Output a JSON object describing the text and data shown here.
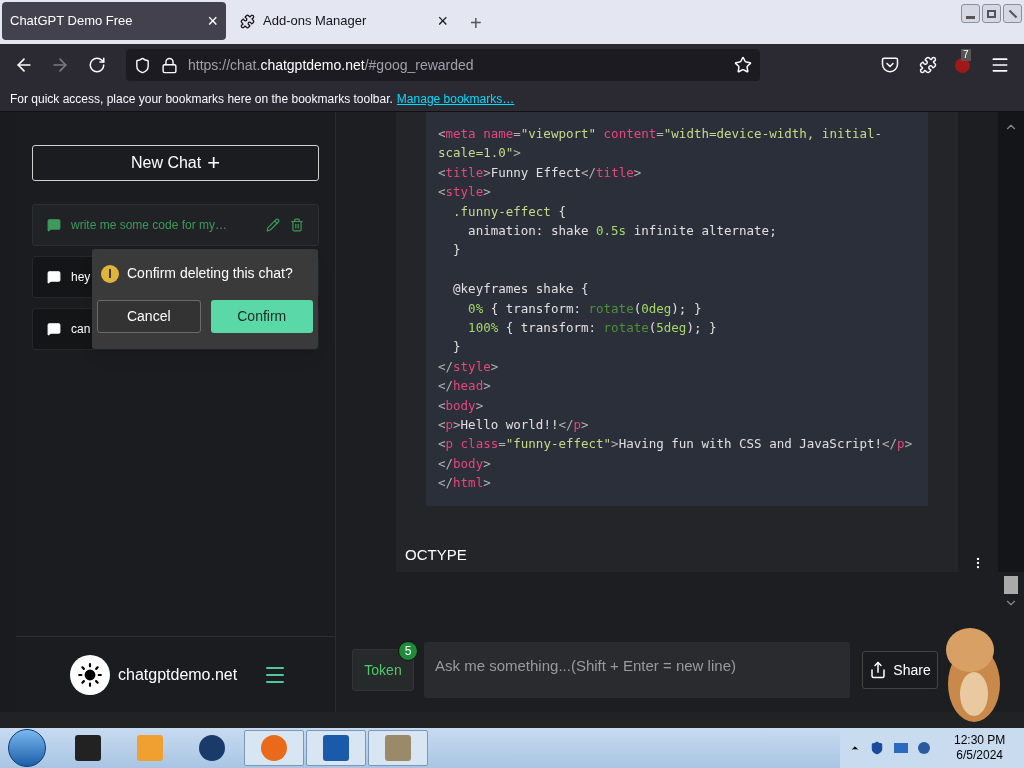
{
  "browser": {
    "tabs": [
      {
        "title": "ChatGPT Demo Free",
        "selected": true,
        "close": "×"
      },
      {
        "title": "Add-ons Manager",
        "selected": false,
        "close": "×"
      }
    ],
    "new_tab": "+",
    "url": {
      "prefix": "https://chat.",
      "domain": "chatgptdemo.net",
      "suffix": "/#goog_rewarded"
    },
    "extension_badge": "7",
    "bookmarks_bar": {
      "text": "For quick access, place your bookmarks here on the bookmarks toolbar.",
      "link": "Manage bookmarks…"
    }
  },
  "sidebar": {
    "new_chat": "New Chat",
    "new_chat_icon": "+",
    "chats": [
      {
        "title": "write me some code for my…",
        "selected": true
      },
      {
        "title": "hey",
        "selected": false
      },
      {
        "title": "can",
        "selected": false
      }
    ],
    "popconfirm": {
      "message": "Confirm deleting this chat?",
      "cancel": "Cancel",
      "confirm": "Confirm"
    },
    "site": "chatgptdemo.net"
  },
  "code": [
    {
      "segments": [
        {
          "kind": "p",
          "text": "<"
        },
        {
          "kind": "t",
          "text": "meta name"
        },
        {
          "kind": "p",
          "text": "="
        },
        {
          "kind": "s",
          "text": "\"viewport\""
        },
        {
          "kind": "t",
          "text": " content"
        },
        {
          "kind": "p",
          "text": "="
        },
        {
          "kind": "s",
          "text": "\"width=device-width, initial-"
        }
      ]
    },
    {
      "segments": [
        {
          "kind": "s",
          "text": "scale=1.0\""
        },
        {
          "kind": "p",
          "text": ">"
        }
      ]
    },
    {
      "segments": [
        {
          "kind": "p",
          "text": "<"
        },
        {
          "kind": "t",
          "text": "title"
        },
        {
          "kind": "p",
          "text": ">"
        },
        {
          "kind": "x",
          "text": "Funny Effect"
        },
        {
          "kind": "p",
          "text": "</"
        },
        {
          "kind": "t",
          "text": "title"
        },
        {
          "kind": "p",
          "text": ">"
        }
      ]
    },
    {
      "segments": [
        {
          "kind": "p",
          "text": "<"
        },
        {
          "kind": "t",
          "text": "style"
        },
        {
          "kind": "p",
          "text": ">"
        }
      ]
    },
    {
      "segments": [
        {
          "kind": "s",
          "text": "  .funny-effect"
        },
        {
          "kind": "x",
          "text": " {"
        }
      ]
    },
    {
      "segments": [
        {
          "kind": "x",
          "text": "    animation: shake "
        },
        {
          "kind": "n",
          "text": "0.5s"
        },
        {
          "kind": "x",
          "text": " infinite alternate;"
        }
      ]
    },
    {
      "segments": [
        {
          "kind": "x",
          "text": "  }"
        }
      ]
    },
    {
      "blank_before": true,
      "segments": [
        {
          "kind": "x",
          "text": "  @keyframes shake {"
        }
      ]
    },
    {
      "segments": [
        {
          "kind": "n",
          "text": "    0%"
        },
        {
          "kind": "x",
          "text": " { transform: "
        },
        {
          "kind": "f",
          "text": "rotate"
        },
        {
          "kind": "x",
          "text": "("
        },
        {
          "kind": "n",
          "text": "0deg"
        },
        {
          "kind": "x",
          "text": "); }"
        }
      ]
    },
    {
      "segments": [
        {
          "kind": "n",
          "text": "    100%"
        },
        {
          "kind": "x",
          "text": " { transform: "
        },
        {
          "kind": "f",
          "text": "rotate"
        },
        {
          "kind": "x",
          "text": "("
        },
        {
          "kind": "n",
          "text": "5deg"
        },
        {
          "kind": "x",
          "text": "); }"
        }
      ]
    },
    {
      "segments": [
        {
          "kind": "x",
          "text": "  }"
        }
      ]
    },
    {
      "segments": [
        {
          "kind": "p",
          "text": "</"
        },
        {
          "kind": "t",
          "text": "style"
        },
        {
          "kind": "p",
          "text": ">"
        }
      ]
    },
    {
      "segments": [
        {
          "kind": "p",
          "text": "</"
        },
        {
          "kind": "t",
          "text": "head"
        },
        {
          "kind": "p",
          "text": ">"
        }
      ]
    },
    {
      "segments": [
        {
          "kind": "p",
          "text": "<"
        },
        {
          "kind": "t",
          "text": "body"
        },
        {
          "kind": "p",
          "text": ">"
        }
      ]
    },
    {
      "segments": [
        {
          "kind": "p",
          "text": "<"
        },
        {
          "kind": "t",
          "text": "p"
        },
        {
          "kind": "p",
          "text": ">"
        },
        {
          "kind": "x",
          "text": "Hello world!!"
        },
        {
          "kind": "p",
          "text": "</"
        },
        {
          "kind": "t",
          "text": "p"
        },
        {
          "kind": "p",
          "text": ">"
        }
      ]
    },
    {
      "segments": [
        {
          "kind": "p",
          "text": "<"
        },
        {
          "kind": "t",
          "text": "p class"
        },
        {
          "kind": "p",
          "text": "="
        },
        {
          "kind": "s",
          "text": "\"funny-effect\""
        },
        {
          "kind": "p",
          "text": ">"
        },
        {
          "kind": "x",
          "text": "Having fun with CSS and JavaScript!"
        },
        {
          "kind": "p",
          "text": "</"
        },
        {
          "kind": "t",
          "text": "p"
        },
        {
          "kind": "p",
          "text": ">"
        }
      ]
    },
    {
      "segments": [
        {
          "kind": "p",
          "text": "</"
        },
        {
          "kind": "t",
          "text": "body"
        },
        {
          "kind": "p",
          "text": ">"
        }
      ]
    },
    {
      "segments": [
        {
          "kind": "p",
          "text": "</"
        },
        {
          "kind": "t",
          "text": "html"
        },
        {
          "kind": "p",
          "text": ">"
        }
      ]
    }
  ],
  "message_tail": "OCTYPE",
  "composer": {
    "token": "Token",
    "token_count": "5",
    "placeholder": "Ask me something...(Shift + Enter = new line)",
    "share": "Share"
  },
  "taskbar": {
    "time": "12:30 PM",
    "date": "6/5/2024"
  }
}
